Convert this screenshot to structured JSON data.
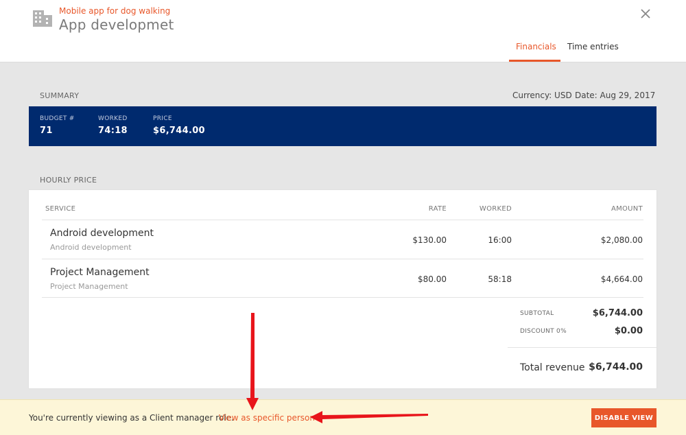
{
  "header": {
    "subtitle": "Mobile app for dog walking",
    "title": "App developmet",
    "tabs": [
      {
        "label": "Financials",
        "active": true
      },
      {
        "label": "Time entries",
        "active": false
      }
    ]
  },
  "summary": {
    "label": "SUMMARY",
    "currency": "Currency: USD",
    "date": "Date: Aug 29, 2017",
    "kpis": [
      {
        "label": "BUDGET #",
        "value": "71"
      },
      {
        "label": "WORKED",
        "value": "74:18"
      },
      {
        "label": "PRICE",
        "value": "$6,744.00"
      }
    ]
  },
  "hourly": {
    "label": "HOURLY PRICE",
    "columns": [
      "SERVICE",
      "RATE",
      "WORKED",
      "AMOUNT"
    ],
    "rows": [
      {
        "name": "Android development",
        "desc": "Android development",
        "rate": "$130.00",
        "worked": "16:00",
        "amount": "$2,080.00"
      },
      {
        "name": "Project Management",
        "desc": "Project Management",
        "rate": "$80.00",
        "worked": "58:18",
        "amount": "$4,664.00"
      }
    ],
    "subtotal_label": "SUBTOTAL",
    "subtotal_value": "$6,744.00",
    "discount_label": "DISCOUNT 0%",
    "discount_value": "$0.00",
    "revenue_label": "Total revenue",
    "revenue_value": "$6,744.00"
  },
  "footer": {
    "text": "You're currently viewing as a Client manager role.",
    "link": "View as specific person",
    "button": "DISABLE VIEW"
  },
  "colors": {
    "accent": "#e8572a",
    "summary_bar": "#002a6e",
    "annotation_arrow": "#e8151b"
  }
}
